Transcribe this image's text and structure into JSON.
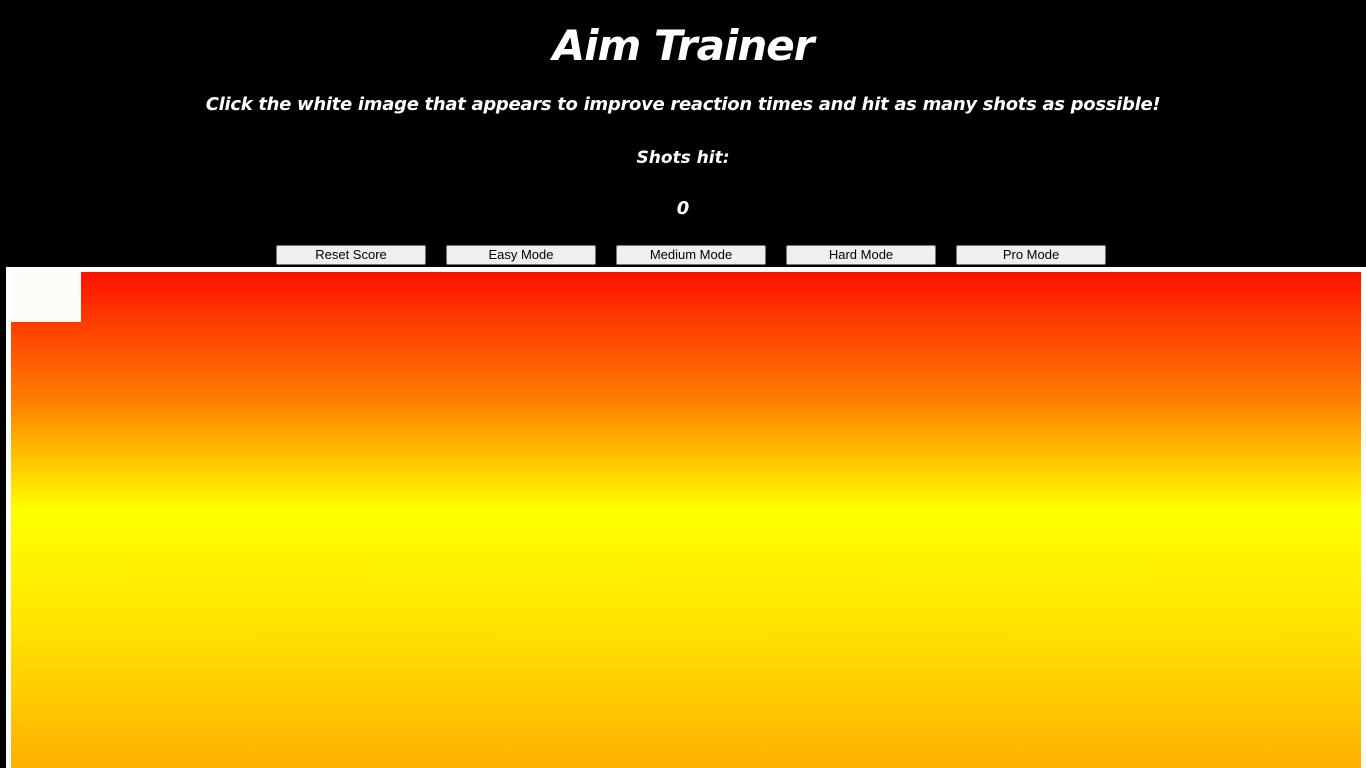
{
  "header": {
    "title": "Aim Trainer",
    "subtitle": "Click the white image that appears to improve reaction times and hit as many shots as possible!"
  },
  "score": {
    "label": "Shots hit:",
    "value": "0"
  },
  "controls": {
    "reset_label": "Reset Score",
    "easy_label": "Easy Mode",
    "medium_label": "Medium Mode",
    "hard_label": "Hard Mode",
    "pro_label": "Pro Mode"
  },
  "game": {
    "background_colors": [
      "#ff1100",
      "#ff7a00",
      "#ffff00",
      "#ffe600",
      "#ffb000"
    ],
    "target_color": "#fbfcf8",
    "frame_color": "#ffffff"
  }
}
